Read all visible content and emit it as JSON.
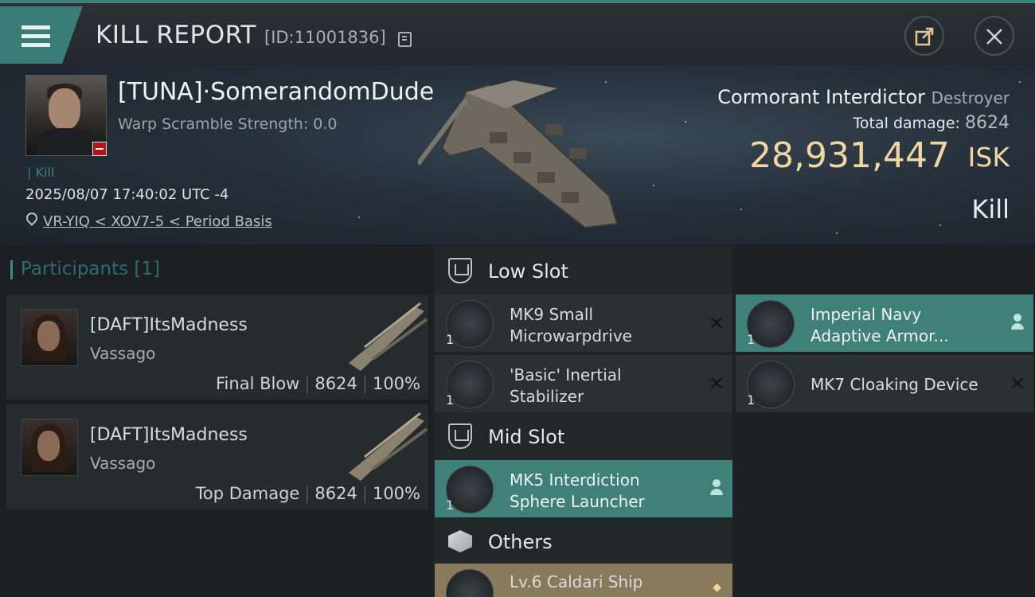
{
  "header": {
    "title": "KILL REPORT",
    "report_id": "[ID:11001836]",
    "icons": {
      "menu": "hamburger-menu-icon",
      "copy": "copy-icon",
      "share": "share-export-icon",
      "close": "close-icon"
    }
  },
  "victim": {
    "name": "[TUNA]·SomerandomDude",
    "warp_scramble": "Warp Scramble Strength: 0.0",
    "kill_tag": "| Kill",
    "datetime": "2025/08/07 17:40:02 UTC -4",
    "location": "VR-YIQ < XOV7-5 < Period Basis",
    "ship_name": "Cormorant Interdictor",
    "ship_class": "Destroyer",
    "total_damage_label": "Total damage:",
    "total_damage": "8624",
    "isk_value": "28,931,447",
    "isk_unit": "ISK",
    "result": "Kill"
  },
  "participants": {
    "title": "Participants [1]",
    "rows": [
      {
        "name": "[DAFT]ItsMadness",
        "ship": "Vassago",
        "role": "Final Blow",
        "damage": "8624",
        "percent": "100%"
      },
      {
        "name": "[DAFT]ItsMadness",
        "ship": "Vassago",
        "role": "Top Damage",
        "damage": "8624",
        "percent": "100%"
      }
    ]
  },
  "fitting": {
    "low_slot": {
      "label": "Low Slot",
      "items": [
        {
          "qty": "1",
          "name": "MK9 Small Microwarpdrive",
          "state": "destroyed"
        },
        {
          "qty": "1",
          "name": "Imperial Navy Adaptive Armor...",
          "state": "dropped"
        },
        {
          "qty": "1",
          "name": "'Basic' Inertial Stabilizer",
          "state": "destroyed"
        },
        {
          "qty": "1",
          "name": "MK7 Cloaking Device",
          "state": "destroyed"
        }
      ]
    },
    "mid_slot": {
      "label": "Mid Slot",
      "items": [
        {
          "qty": "1",
          "name": "MK5 Interdiction Sphere Launcher",
          "state": "dropped"
        }
      ]
    },
    "others": {
      "label": "Others",
      "items": [
        {
          "qty": "",
          "name": "Lv.6 Caldari Ship",
          "state": "special"
        }
      ]
    }
  },
  "colors": {
    "accent": "#3e7f78",
    "isk": "#f1d6a2",
    "victim_badge": "#b3151b",
    "gold_item": "#8a7a5c"
  }
}
